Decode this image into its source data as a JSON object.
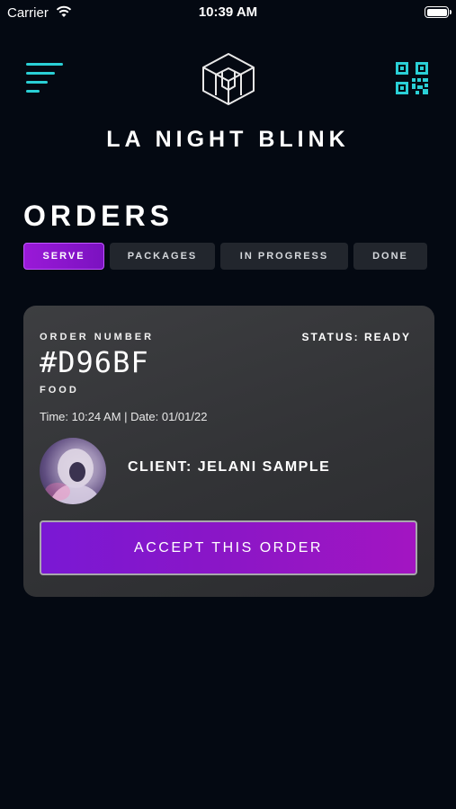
{
  "status_bar": {
    "carrier": "Carrier",
    "time": "10:39 AM"
  },
  "header": {
    "brand": "LA NIGHT BLINK",
    "menu_icon": "menu-icon",
    "logo_icon": "logo-icon",
    "qr_icon": "qr-code-icon"
  },
  "page": {
    "title": "ORDERS"
  },
  "tabs": [
    {
      "label": "SERVE",
      "active": true
    },
    {
      "label": "PACKAGES",
      "active": false
    },
    {
      "label": "IN PROGRESS",
      "active": false
    },
    {
      "label": "DONE",
      "active": false
    }
  ],
  "order": {
    "label": "ORDER NUMBER",
    "number": "#D96BF",
    "status": "STATUS: READY",
    "category": "FOOD",
    "datetime": "Time: 10:24 AM | Date: 01/01/22",
    "client": "CLIENT: JELANI SAMPLE",
    "accept_label": "ACCEPT THIS ORDER"
  },
  "colors": {
    "accent_cyan": "#2ad0d6",
    "accent_purple": "#8b16c6",
    "background": "#040912",
    "card": "#38393c"
  }
}
